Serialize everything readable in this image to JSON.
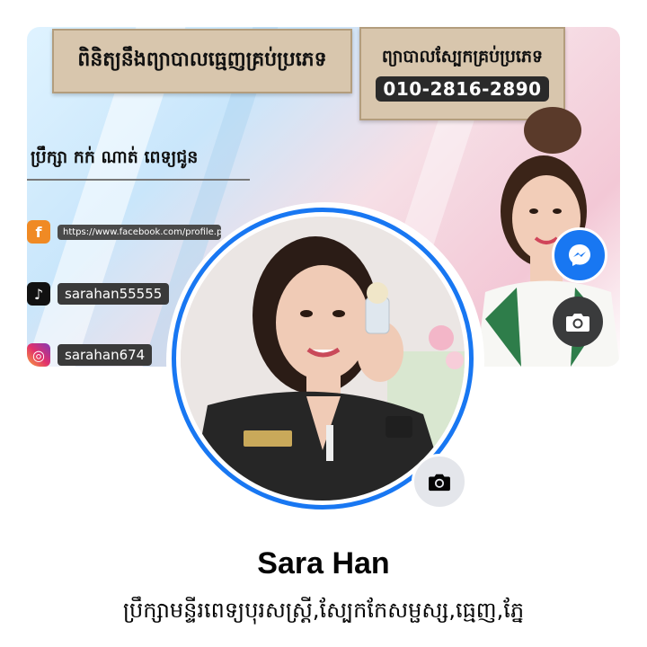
{
  "cover": {
    "banner_title": "ពិនិត្យនឹងព្យាបាលធ្មេញគ្រប់ប្រភេទ",
    "banner_right_title": "ព្យាបាលស្បែកគ្រប់ប្រភេទ",
    "phone": "010-2816-2890",
    "consult_text": "ប្រឹក្សា កក់ ណាត់ ពេទ្យជូន",
    "social": {
      "facebook_url": "https://www.facebook.com/profile.php",
      "tiktok_handle": "sarahan55555",
      "instagram_handle": "sarahan674"
    }
  },
  "profile": {
    "name": "Sara Han",
    "bio": "ប្រឹក្សាមន្ទីរពេទ្យបុរសស្ត្រី,ស្បែកកែសម្ផស្ស,ធ្មេញ,ភ្នែ"
  },
  "icons": {
    "messenger": "messenger-icon",
    "cover_camera": "camera-icon",
    "avatar_camera": "camera-icon"
  },
  "colors": {
    "accent": "#1877f2",
    "text": "#050505",
    "button_gray": "#e4e6eb",
    "dark_button": "#3a3b3c"
  }
}
